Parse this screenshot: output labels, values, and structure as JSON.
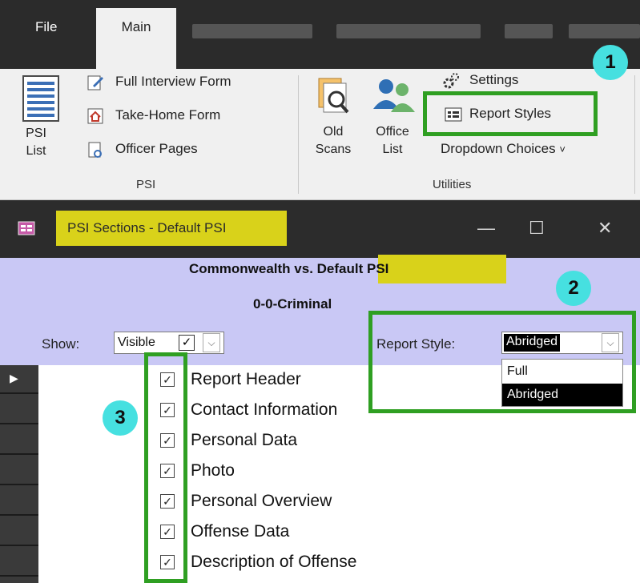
{
  "ribbon": {
    "tabs": {
      "file": "File",
      "main": "Main"
    },
    "psi_group": {
      "label": "PSI",
      "psi_list_line1": "PSI",
      "psi_list_line2": "List",
      "full_interview_form": "Full Interview Form",
      "take_home_form": "Take-Home Form",
      "officer_pages": "Officer Pages"
    },
    "utilities_group": {
      "label": "Utilities",
      "old_scans_line1": "Old",
      "old_scans_line2": "Scans",
      "office_list_line1": "Office",
      "office_list_line2": "List",
      "settings": "Settings",
      "report_styles": "Report Styles",
      "dropdown_choices": "Dropdown Choices",
      "dropdown_choices_arrow": "˅"
    }
  },
  "window": {
    "title": "PSI Sections - Default PSI",
    "minimize": "—",
    "maximize": "☐",
    "close": "✕"
  },
  "form_header": {
    "title_prefix": "Commonwealth vs.",
    "title_highlight": "Default PSI",
    "case_number": "0-0-Criminal",
    "show_label": "Show:",
    "show_value": "Visible",
    "report_style_label": "Report Style:",
    "report_style_value": "Abridged"
  },
  "report_style_options": [
    "Full",
    "Abridged"
  ],
  "sections": [
    "Report Header",
    "Contact Information",
    "Personal Data",
    "Photo",
    "Personal Overview",
    "Offense Data",
    "Description of Offense"
  ],
  "callouts": [
    "1",
    "2",
    "3"
  ],
  "colors": {
    "highlight_yellow": "#d9d21a",
    "callout_green": "#2f9f22",
    "badge_cyan": "#46e0e0",
    "header_lavender": "#c9c8f5"
  }
}
